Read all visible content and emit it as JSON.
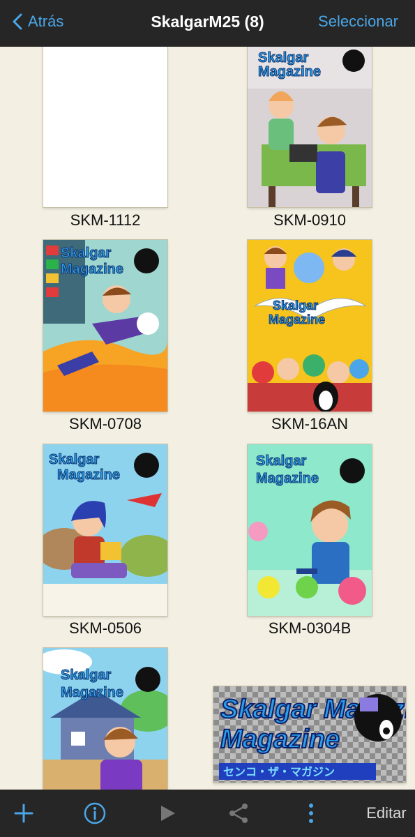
{
  "header": {
    "back_label": "Atrás",
    "title": "SkalgarM25 (8)",
    "select_label": "Seleccionar"
  },
  "grid": {
    "items": [
      {
        "label": "SKM-1112",
        "cover": "blank-white-cover"
      },
      {
        "label": "SKM-0910",
        "cover": "magazine-cover-classroom-scene"
      },
      {
        "label": "SKM-0708",
        "cover": "magazine-cover-running-character"
      },
      {
        "label": "SKM-16AN",
        "cover": "magazine-cover-anniversary-group"
      },
      {
        "label": "SKM-0506",
        "cover": "magazine-cover-reading-character"
      },
      {
        "label": "SKM-0304B",
        "cover": "magazine-cover-pink-creatures"
      },
      {
        "label": "",
        "cover": "magazine-cover-house-scene"
      },
      {
        "label": "",
        "cover": "logo-transparent-checkerboard"
      }
    ],
    "cover_logo_text": "Skalgar Magazine",
    "cover_logo_subtitle": "センコ・ザ・マガジン"
  },
  "toolbar": {
    "add": "plus-icon",
    "info": "info-icon",
    "play": "play-icon",
    "share": "share-icon",
    "more": "more-vertical-icon",
    "edit_label": "Editar"
  },
  "colors": {
    "bar": "#262626",
    "accent": "#4aa6e8",
    "background": "#f3f0e3"
  }
}
